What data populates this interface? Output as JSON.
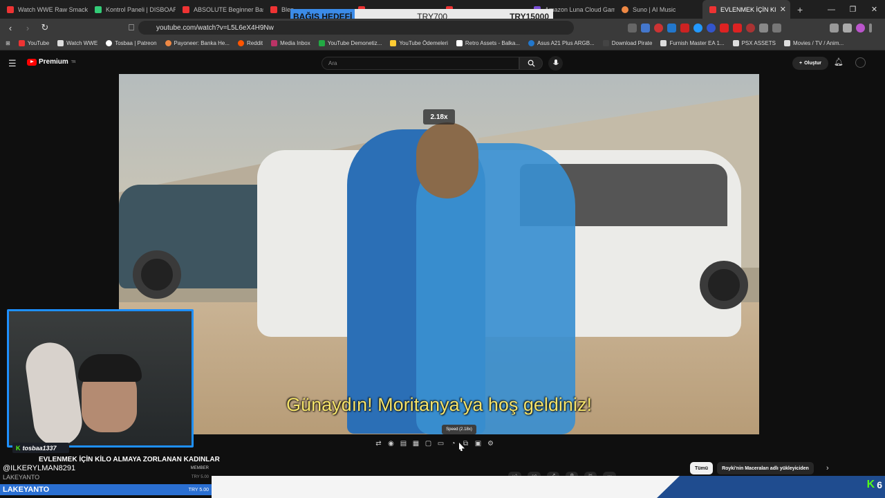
{
  "browser": {
    "tabs": [
      {
        "label": "Watch WWE Raw SmackD",
        "color": "#e33"
      },
      {
        "label": "Kontrol Paneli | DISBOARD",
        "color": "#3c7"
      },
      {
        "label": "ABSOLUTE Beginner Basic",
        "color": "#e33"
      },
      {
        "label": "Blen",
        "color": "#e33"
      },
      {
        "label": "",
        "color": "#e33"
      },
      {
        "label": "",
        "color": "#e33"
      },
      {
        "label": "Amazon Luna Cloud Gami",
        "color": "#7a4fd6"
      },
      {
        "label": "Suno | AI Music",
        "color": "#e84"
      },
      {
        "label": "EVLENMEK İÇİN KI",
        "color": "#e33",
        "active": true
      }
    ],
    "new_tab": "+",
    "url": "youtube.com/watch?v=L5L6eX4H9Nw",
    "bookmarks": [
      {
        "label": "YouTube",
        "color": "#e33"
      },
      {
        "label": "Watch WWE",
        "color": "#ddd"
      },
      {
        "label": "Tosbaa | Patreon",
        "color": "#fff"
      },
      {
        "label": "Payoneer: Banka He...",
        "color": "#e84"
      },
      {
        "label": "Reddit",
        "color": "#f50"
      },
      {
        "label": "Media Inbox",
        "color": "#b36"
      },
      {
        "label": "YouTube Demonetiz...",
        "color": "#2a4"
      },
      {
        "label": "YouTube Ödemeleri",
        "color": "#fc3"
      },
      {
        "label": "Retro Assets - Balka...",
        "color": "#fff"
      },
      {
        "label": "Asus A21 Plus ARGB...",
        "color": "#27c"
      },
      {
        "label": "Download Pirate",
        "color": "#444"
      },
      {
        "label": "Furnish Master EA 1...",
        "color": "#ddd"
      },
      {
        "label": "PSX ASSETS",
        "color": "#ddd"
      },
      {
        "label": "Movies / TV / Anim...",
        "color": "#ddd"
      }
    ]
  },
  "donation": {
    "label": "BAĞIŞ HEDEFİ",
    "current": "TRY700",
    "target": "TRY15000"
  },
  "youtube": {
    "logo_text": "Premium",
    "logo_sup": "TR",
    "search_placeholder": "Ara",
    "create_label": "Oluştur",
    "speed_overlay": "2.18x",
    "subtitle": "Günaydın! Moritanya'ya hoş geldiniz!",
    "speed_tooltip": "Speed (2.18x)",
    "video_title": "EVLENMEK İÇİN KİLO ALMAYA ZORLANAN KADINLAR",
    "channel_name": "Royki'nin Maceraları",
    "chips": [
      {
        "label": "Tümü",
        "active": true
      },
      {
        "label": "Royki'nin Maceraları adlı yükleyiciden",
        "active": false
      }
    ]
  },
  "stream": {
    "cam_username": "tosbaa1337",
    "chat": [
      {
        "user": "@ILKERYLMAN8291",
        "badge": "MEMBER"
      },
      {
        "user": "LAKEYANTO",
        "amount": "TRY 5.00"
      },
      {
        "user": "LAKEYANTO",
        "amount": "TRY 5.00"
      }
    ],
    "footer_count": "6"
  }
}
